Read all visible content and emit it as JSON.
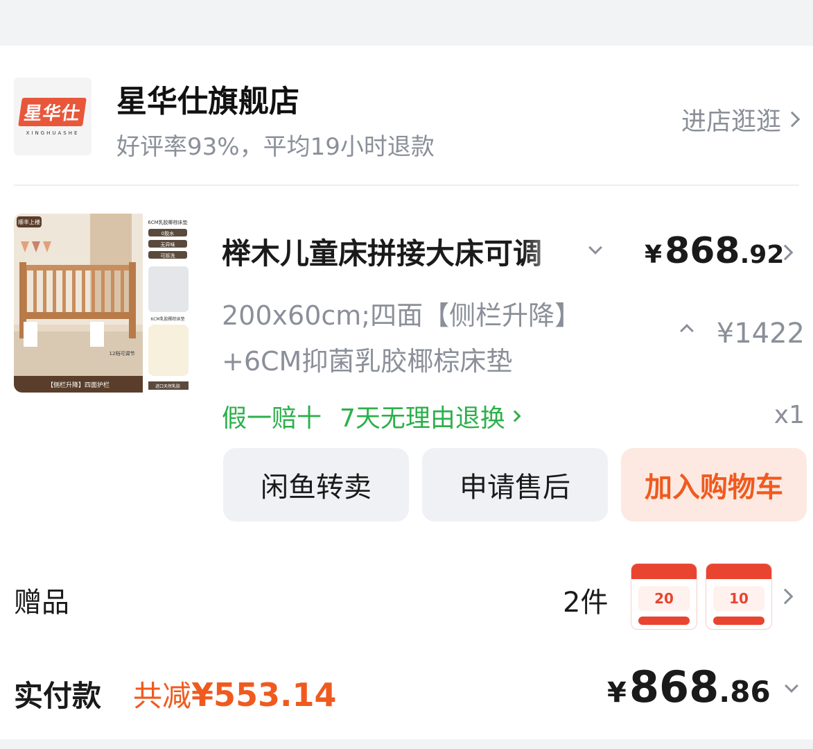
{
  "shop": {
    "logo_text": "星华仕",
    "logo_subtext": "XINGHUASHE",
    "name": "星华仕旗舰店",
    "stats": "好评率93%，平均19小时退款",
    "visit_label": "进店逛逛"
  },
  "product": {
    "title": "榉木儿童床拼接大床可调",
    "price_currency": "¥",
    "price_integer": "868",
    "price_decimal": ".92",
    "sku_line1": "200x60cm;四面【侧栏升降】",
    "sku_line2": "+6CM抑菌乳胶椰棕床垫",
    "original_price": "¥1422",
    "guarantee_1": "假一赔十",
    "guarantee_2": "7天无理由退换",
    "quantity": "x1",
    "image_labels": {
      "badge": "顺丰上楼",
      "mattress_title": "6CM乳胶椰棕床垫",
      "feature_1": "0胶水",
      "feature_2": "无异味",
      "feature_3": "可拆洗",
      "mattress_name": "6CM乳胶椰棕床垫",
      "height_note": "12档可调节",
      "latex_note": "进口天然乳胶",
      "bottom_banner": "【侧栏升降】四面护栏"
    }
  },
  "actions": {
    "resell_label": "闲鱼转卖",
    "aftersale_label": "申请售后",
    "add_cart_label": "加入购物车"
  },
  "gifts": {
    "label": "赠品",
    "count": "2件",
    "coupon_1_amount": "20",
    "coupon_2_amount": "10"
  },
  "payment": {
    "label": "实付款",
    "discount_prefix": "共减",
    "discount_value": "¥553.14",
    "total_currency": "¥",
    "total_integer": "868",
    "total_decimal": ".86"
  },
  "colors": {
    "accent_orange": "#f05a1e",
    "guarantee_green": "#2bb04a",
    "muted_gray": "#8a8f99"
  }
}
